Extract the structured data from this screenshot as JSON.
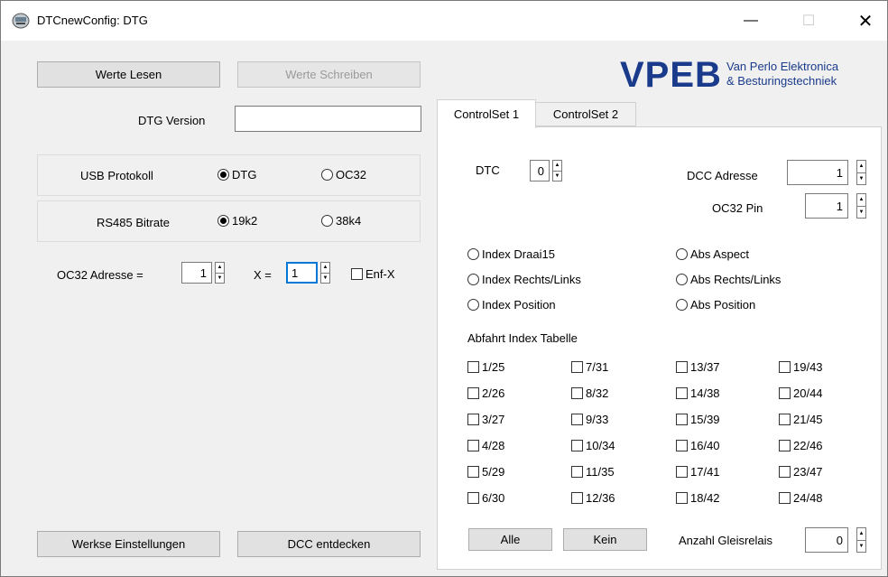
{
  "window": {
    "title": "DTCnewConfig: DTG",
    "minimize": "—",
    "maximize": "☐",
    "close": "✕"
  },
  "buttons": {
    "read": "Werte Lesen",
    "write": "Werte Schreiben",
    "factory": "Werkse Einstellungen",
    "dcc_detect": "DCC entdecken"
  },
  "logo": {
    "main": "VPEB",
    "line1": "Van Perlo Elektronica",
    "line2": "& Besturingstechniek",
    "color": "#1a3a8c"
  },
  "dtg_version": {
    "label": "DTG Version",
    "value": ""
  },
  "usb": {
    "label": "USB Protokoll",
    "opt1": "DTG",
    "opt2": "OC32",
    "selected": "DTG"
  },
  "rs485": {
    "label": "RS485 Bitrate",
    "opt1": "19k2",
    "opt2": "38k4",
    "selected": "19k2"
  },
  "oc32": {
    "label": "OC32 Adresse =",
    "value": "1",
    "x_label": "X =",
    "x_value": "1",
    "enf_label": "Enf-X"
  },
  "tabs": {
    "tab1": "ControlSet 1",
    "tab2": "ControlSet 2",
    "active": "ControlSet 1"
  },
  "controlset": {
    "dtc_label": "DTC",
    "dtc_value": "0",
    "dcc_label": "DCC Adresse",
    "dcc_value": "1",
    "oc32pin_label": "OC32 Pin",
    "oc32pin_value": "1",
    "modes": [
      "Index Draai15",
      "Abs Aspect",
      "Index Rechts/Links",
      "Abs Rechts/Links",
      "Index Position",
      "Abs Position"
    ],
    "table_label": "Abfahrt Index Tabelle",
    "table": [
      [
        "1/25",
        "7/31",
        "13/37",
        "19/43"
      ],
      [
        "2/26",
        "8/32",
        "14/38",
        "20/44"
      ],
      [
        "3/27",
        "9/33",
        "15/39",
        "21/45"
      ],
      [
        "4/28",
        "10/34",
        "16/40",
        "22/46"
      ],
      [
        "5/29",
        "11/35",
        "17/41",
        "23/47"
      ],
      [
        "6/30",
        "12/36",
        "18/42",
        "24/48"
      ]
    ],
    "all_btn": "Alle",
    "none_btn": "Kein",
    "relais_label": "Anzahl Gleisrelais",
    "relais_value": "0"
  }
}
